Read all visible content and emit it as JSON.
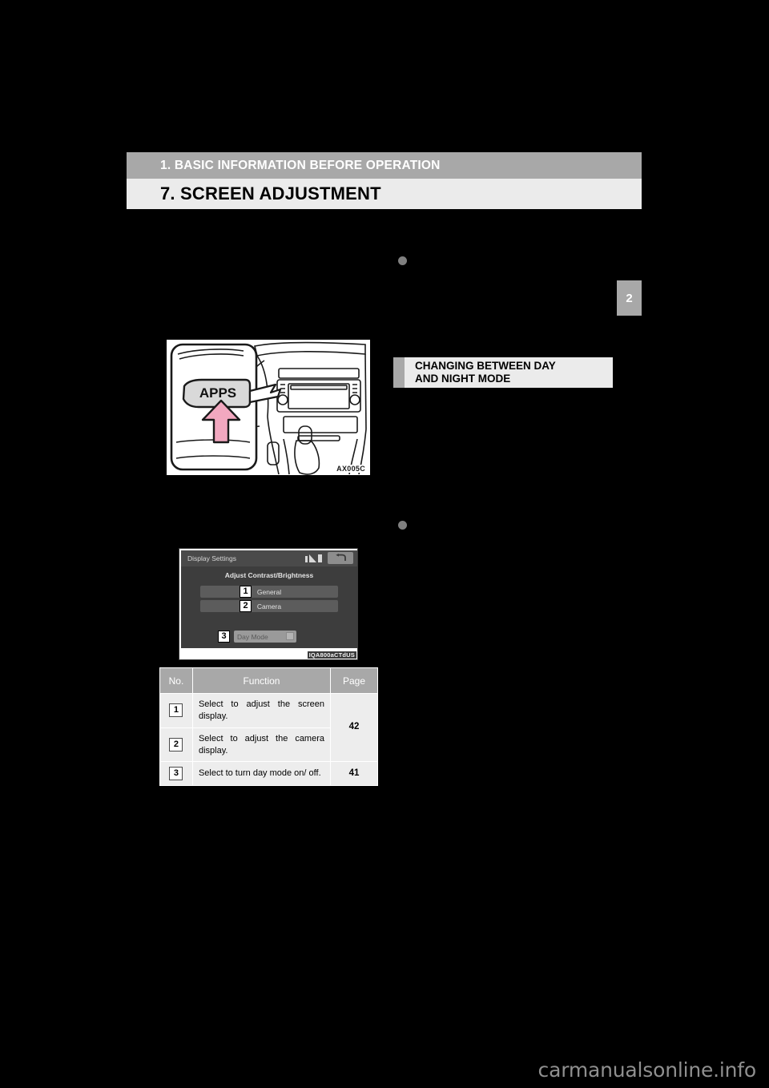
{
  "page": {
    "background_color": "#000000",
    "chapter_tab": "2",
    "watermark": "carmanualsonline.info"
  },
  "header": {
    "chapter_title": "1. BASIC INFORMATION BEFORE OPERATION",
    "section_title": "7. SCREEN ADJUSTMENT",
    "chapter_bar_color": "#a8a8a8",
    "section_bar_color": "#ebebeb"
  },
  "subheading": {
    "line1": "CHANGING BETWEEN DAY",
    "line2": "AND NIGHT MODE",
    "marker_color": "#a8a8a8",
    "box_color": "#ebebeb"
  },
  "figures": {
    "car": {
      "button_label": "APPS",
      "code": "AX005C",
      "arrow_color": "#f2a8c0"
    },
    "screen": {
      "title": "Display Settings",
      "subtitle": "Adjust Contrast/Brightness",
      "rows": [
        {
          "callout": "1",
          "label": "General"
        },
        {
          "callout": "2",
          "label": "Camera"
        }
      ],
      "day_mode": {
        "callout": "3",
        "label": "Day Mode"
      },
      "status_icons": [
        "bluetooth-icon",
        "signal-icon",
        "battery-icon"
      ],
      "back_icon": "return-arrow-icon",
      "code": "IQA800aCTdUS"
    }
  },
  "table": {
    "headers": [
      "No.",
      "Function",
      "Page"
    ],
    "rows": [
      {
        "no": "1",
        "function": "Select to adjust the screen display.",
        "page": "42",
        "page_rowspan": 2
      },
      {
        "no": "2",
        "function": "Select to adjust the camera display.",
        "page": "",
        "page_rowspan": 0
      },
      {
        "no": "3",
        "function": "Select to turn day mode on/ off.",
        "page": "41",
        "page_rowspan": 1
      }
    ]
  }
}
